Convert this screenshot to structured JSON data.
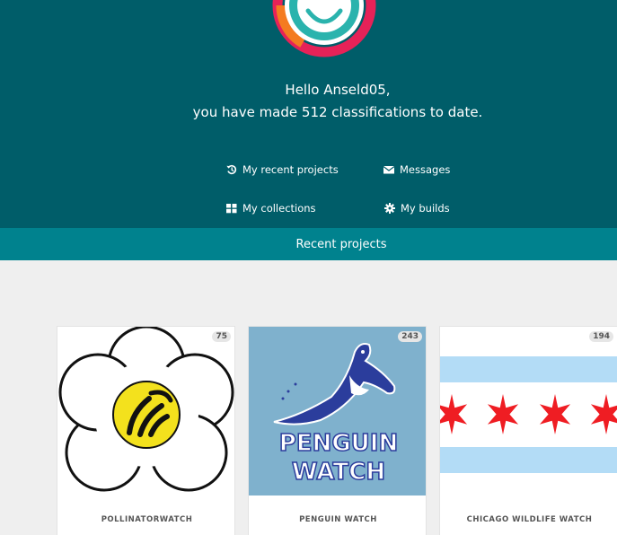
{
  "user": {
    "greeting_line1": "Hello Anseld05,",
    "greeting_line2": "you have made 512 classifications to date."
  },
  "nav": {
    "recent_projects": "My recent projects",
    "messages": "Messages",
    "collections": "My collections",
    "builds": "My builds"
  },
  "section_bar": {
    "label": "Recent projects"
  },
  "projects": [
    {
      "title": "POLLINATORWATCH",
      "count": "75"
    },
    {
      "title": "PENGUIN WATCH",
      "count": "243",
      "logo_text_1": "PENGUIN",
      "logo_text_2": "WATCH"
    },
    {
      "title": "CHICAGO WILDLIFE WATCH",
      "count": "194"
    }
  ],
  "colors": {
    "hero_bg": "#005d69",
    "bar_bg": "#00828e",
    "page_bg": "#efefef",
    "penguin_bg": "#7fb1cd",
    "penguin_blue": "#2b3d9c",
    "flag_blue": "#b3dcf6",
    "flag_red": "#ef1d23",
    "bee_yellow": "#f3e11d"
  },
  "icons": {
    "recent": "history-icon",
    "messages": "envelope-icon",
    "collections": "grid-icon",
    "builds": "gear-icon"
  }
}
